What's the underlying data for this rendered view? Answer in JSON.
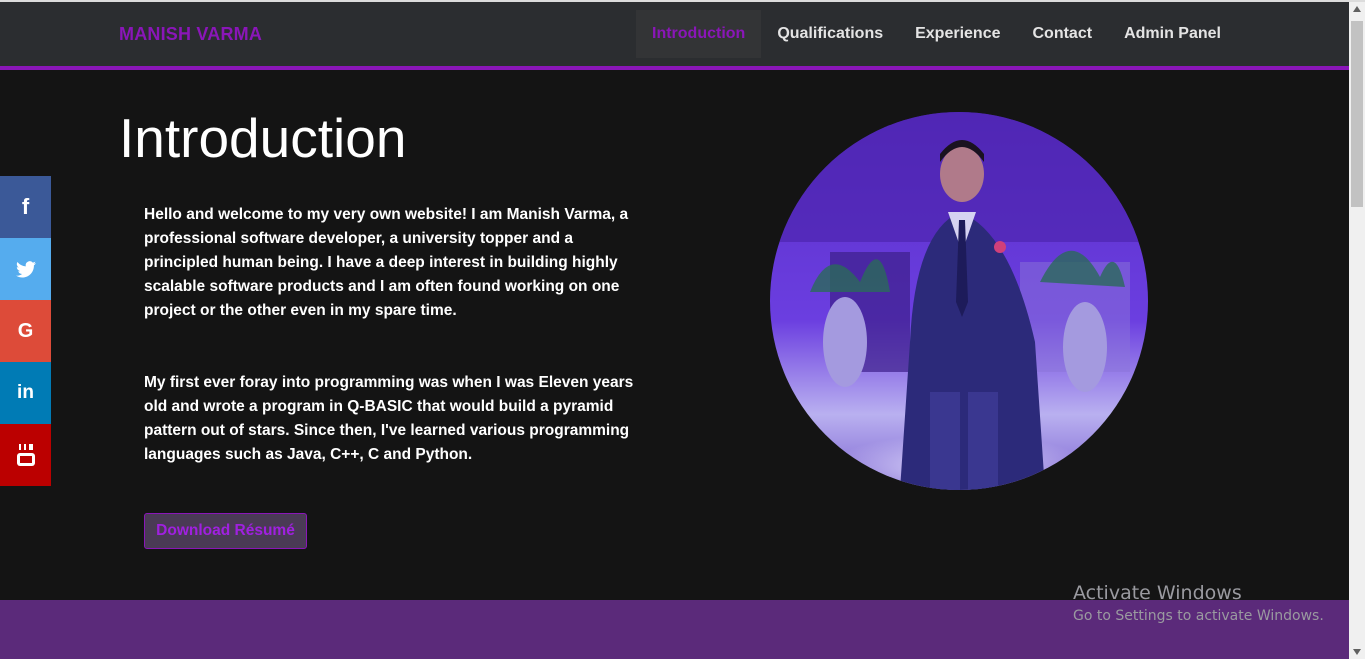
{
  "brand": "MANISH VARMA",
  "nav": [
    "Introduction",
    "Qualifications",
    "Experience",
    "Contact",
    "Admin Panel"
  ],
  "nav_active": "Introduction",
  "main": {
    "title": "Introduction",
    "paragraph1": "Hello and welcome to my very own website! I am Manish Varma, a professional software developer, a university topper and a principled human being. I have a deep interest in building highly scalable software products and I am often found working on one project or the other even in my spare time.",
    "paragraph2": "My first ever foray into programming was when I was Eleven years old and wrote a program in Q-BASIC that would build a pyramid pattern out of stars. Since then, I've learned various programming languages such as Java, C++, C and Python.",
    "download_label": "Download Résumé"
  },
  "social": [
    {
      "name": "facebook",
      "icon": "facebook-icon",
      "glyph": "f",
      "color": "#3b5998"
    },
    {
      "name": "twitter",
      "icon": "twitter-icon",
      "glyph": "",
      "color": "#55acee"
    },
    {
      "name": "google",
      "icon": "google-icon",
      "glyph": "G",
      "color": "#dd4b39"
    },
    {
      "name": "linkedin",
      "icon": "linkedin-icon",
      "glyph": "in",
      "color": "#007bb5"
    },
    {
      "name": "youtube",
      "icon": "youtube-icon",
      "glyph": "",
      "color": "#bb0000"
    }
  ],
  "watermark": {
    "title": "Activate Windows",
    "subtitle": "Go to Settings to activate Windows."
  },
  "colors": {
    "accent": "#8a16b8",
    "navbar": "#2b2d30",
    "background": "#141414",
    "footer": "#5b2a7a"
  }
}
